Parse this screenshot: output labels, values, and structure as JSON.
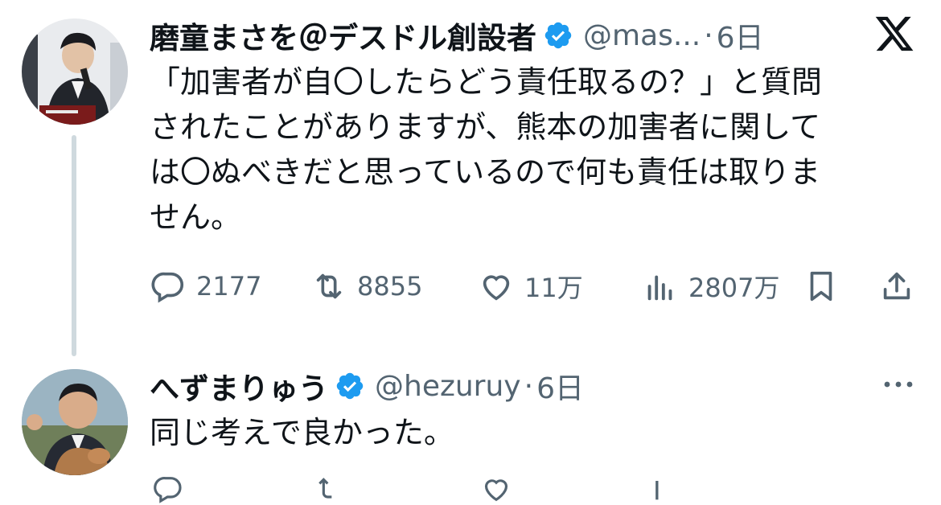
{
  "tweet1": {
    "display_name": "磨童まさを＠デスドル創設者",
    "handle": "@mas...",
    "separator": "·",
    "time": "6日",
    "text": "「加害者が自〇したらどう責任取るの？」と質問\nされたことがありますが、熊本の加害者に関して\nは〇ぬべきだと思っているので何も責任は取りま\nせん。",
    "actions": {
      "replies": "2177",
      "retweets": "8855",
      "likes": "11万",
      "views": "2807万"
    },
    "icons": [
      "reply-icon",
      "retweet-icon",
      "like-icon",
      "views-icon",
      "bookmark-icon",
      "share-icon"
    ]
  },
  "tweet2": {
    "display_name": "へずまりゅう",
    "handle": "@hezuruy",
    "separator": "·",
    "time": "6日",
    "text": "同じ考えで良かった。"
  },
  "colors": {
    "verified": "#1d9bf0",
    "secondary_text": "#536471",
    "primary_text": "#0f1419",
    "thread_line": "#cfd9de"
  }
}
